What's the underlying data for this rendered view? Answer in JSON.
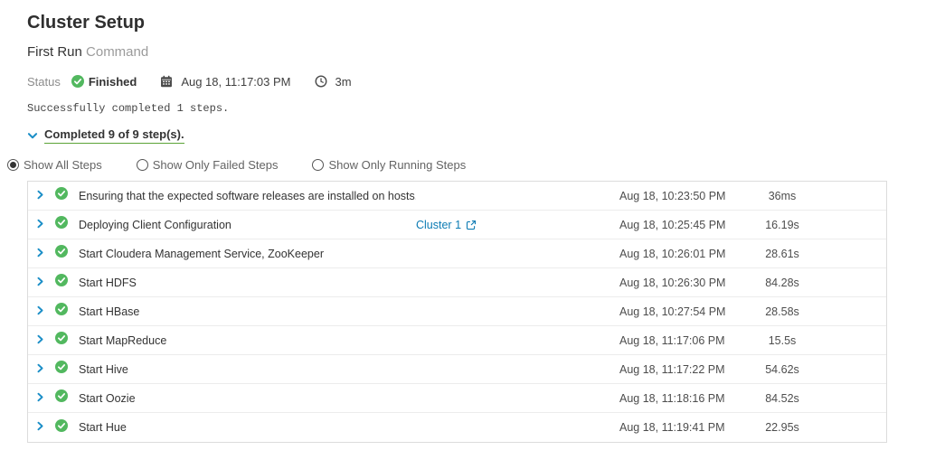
{
  "page": {
    "title": "Cluster Setup",
    "subtitle_strong": "First Run",
    "subtitle_light": "Command"
  },
  "status": {
    "label": "Status",
    "value": "Finished",
    "timestamp": "Aug 18, 11:17:03 PM",
    "duration": "3m"
  },
  "message": "Successfully completed 1 steps.",
  "progress": {
    "summary": "Completed 9 of 9 step(s)."
  },
  "filters": [
    {
      "label": "Show All Steps",
      "selected": true
    },
    {
      "label": "Show Only Failed Steps",
      "selected": false
    },
    {
      "label": "Show Only Running Steps",
      "selected": false
    }
  ],
  "steps": [
    {
      "label": "Ensuring that the expected software releases are installed on hosts.",
      "context": "",
      "time": "Aug 18, 10:23:50 PM",
      "duration": "36ms"
    },
    {
      "label": "Deploying Client Configuration",
      "context": "Cluster 1",
      "time": "Aug 18, 10:25:45 PM",
      "duration": "16.19s"
    },
    {
      "label": "Start Cloudera Management Service, ZooKeeper",
      "context": "",
      "time": "Aug 18, 10:26:01 PM",
      "duration": "28.61s"
    },
    {
      "label": "Start HDFS",
      "context": "",
      "time": "Aug 18, 10:26:30 PM",
      "duration": "84.28s"
    },
    {
      "label": "Start HBase",
      "context": "",
      "time": "Aug 18, 10:27:54 PM",
      "duration": "28.58s"
    },
    {
      "label": "Start MapReduce",
      "context": "",
      "time": "Aug 18, 11:17:06 PM",
      "duration": "15.5s"
    },
    {
      "label": "Start Hive",
      "context": "",
      "time": "Aug 18, 11:17:22 PM",
      "duration": "54.62s"
    },
    {
      "label": "Start Oozie",
      "context": "",
      "time": "Aug 18, 11:18:16 PM",
      "duration": "84.52s"
    },
    {
      "label": "Start Hue",
      "context": "",
      "time": "Aug 18, 11:19:41 PM",
      "duration": "22.95s"
    }
  ],
  "colors": {
    "success_green": "#52b85f",
    "underline_green": "#5ba437",
    "accent_blue": "#1b8ec7",
    "link_blue": "#0d7cb4",
    "text_dark": "#333333",
    "text_muted": "#8c8c8c",
    "row_border": "#ececec",
    "table_border": "#dcdcdc"
  }
}
